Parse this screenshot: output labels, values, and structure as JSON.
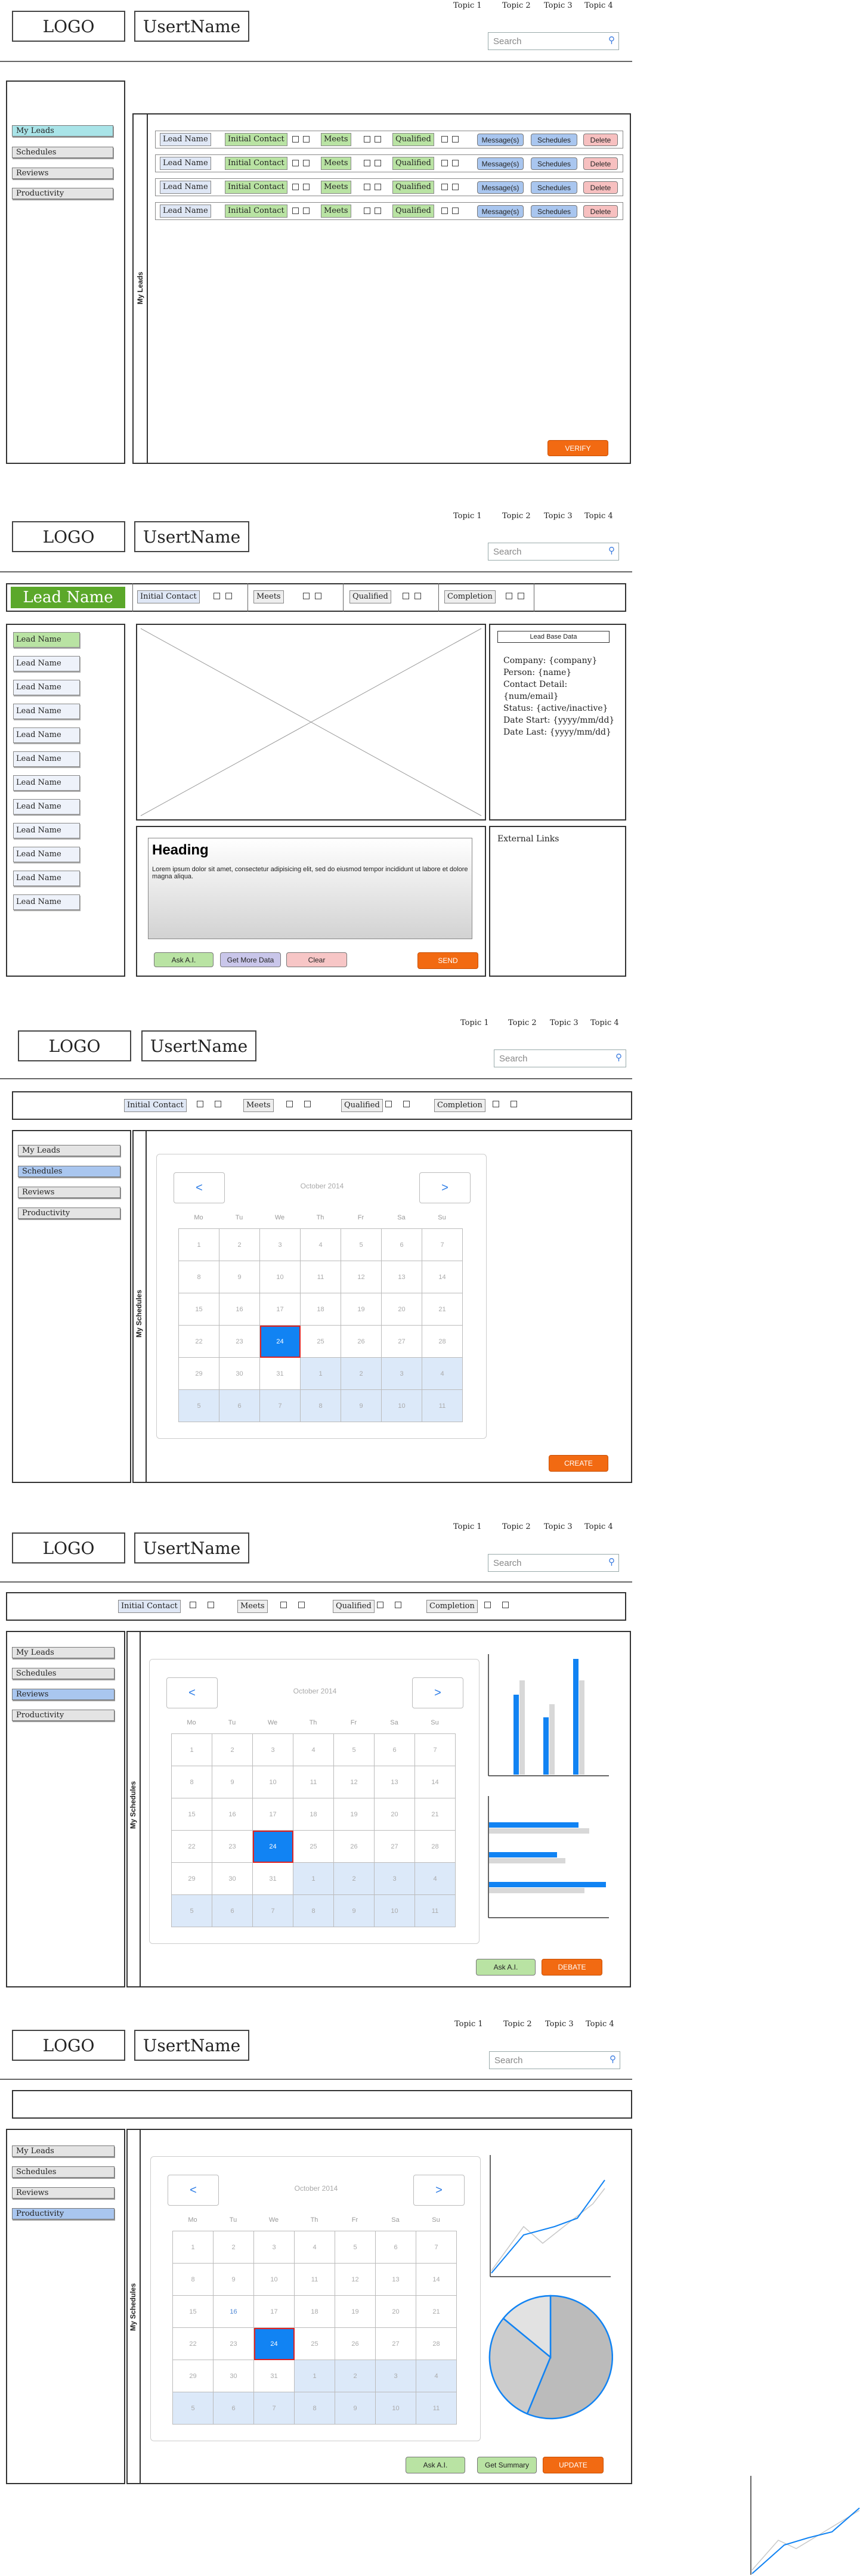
{
  "header": {
    "logo": "LOGO",
    "username": "UsertName",
    "topics": [
      "Topic 1",
      "Topic 2",
      "Topic 3",
      "Topic 4"
    ],
    "search_placeholder": "Search"
  },
  "sidebar_items": [
    "My Leads",
    "Schedules",
    "Reviews",
    "Productivity"
  ],
  "status_chips": {
    "initial": "Initial Contact",
    "meets": "Meets",
    "qualified": "Qualified",
    "completion": "Completion"
  },
  "screen1": {
    "vertical_label": "My Leads",
    "rows": [
      {
        "lead": "Lead Name",
        "initial": "Initial Contact",
        "meets": "Meets",
        "qualified": "Qualified",
        "messages": "Message(s)",
        "schedules": "Schedules",
        "delete": "Delete"
      },
      {
        "lead": "Lead Name",
        "initial": "Initial Contact",
        "meets": "Meets",
        "qualified": "Qualified",
        "messages": "Message(s)",
        "schedules": "Schedules",
        "delete": "Delete"
      },
      {
        "lead": "Lead Name",
        "initial": "Initial Contact",
        "meets": "Meets",
        "qualified": "Qualified",
        "messages": "Message(s)",
        "schedules": "Schedules",
        "delete": "Delete"
      },
      {
        "lead": "Lead Name",
        "initial": "Initial Contact",
        "meets": "Meets",
        "qualified": "Qualified",
        "messages": "Message(s)",
        "schedules": "Schedules",
        "delete": "Delete"
      }
    ],
    "verify_label": "VERIFY"
  },
  "screen2": {
    "lead_banner": "Lead Name",
    "lead_list": [
      "Lead Name",
      "Lead Name",
      "Lead Name",
      "Lead Name",
      "Lead Name",
      "Lead Name",
      "Lead Name",
      "Lead Name",
      "Lead Name",
      "Lead Name",
      "Lead Name",
      "Lead Name"
    ],
    "heading": "Heading",
    "paragraph": "Lorem ipsum dolor sit amet, consectetur adipisicing elit, sed do eiusmod tempor incididunt ut labore et dolore magna aliqua.",
    "buttons": {
      "ask": "Ask A.I.",
      "more": "Get More Data",
      "clear": "Clear",
      "send": "SEND"
    },
    "lead_base_title": "Lead Base Data",
    "details": [
      "Company: {company}",
      "Person: {name}",
      "Contact Detail: {num/email}",
      "Status: {active/inactive}",
      "Date Start: {yyyy/mm/dd}",
      "Date Last: {yyyy/mm/dd}"
    ],
    "external_links": "External Links"
  },
  "calendar": {
    "month": "October 2014",
    "prev": "<",
    "next": ">",
    "dow": [
      "Mo",
      "Tu",
      "We",
      "Th",
      "Fr",
      "Sa",
      "Su"
    ],
    "days": [
      "1",
      "2",
      "3",
      "4",
      "5",
      "6",
      "7",
      "8",
      "9",
      "10",
      "11",
      "12",
      "13",
      "14",
      "15",
      "16",
      "17",
      "18",
      "19",
      "20",
      "21",
      "22",
      "23",
      "24",
      "25",
      "26",
      "27",
      "28",
      "29",
      "30",
      "31",
      "1",
      "2",
      "3",
      "4",
      "5",
      "6",
      "7",
      "8",
      "9",
      "10",
      "11"
    ],
    "today": "24"
  },
  "screen3": {
    "vertical_label": "My Schedules",
    "create": "CREATE"
  },
  "screen4": {
    "vertical_label": "My Schedules",
    "ask": "Ask A.I.",
    "debate": "DEBATE"
  },
  "screen5": {
    "vertical_label": "My Schedules",
    "ask": "Ask A.I.",
    "summary": "Get Summary",
    "update": "UPDATE"
  },
  "colors": {
    "accent_orange": "#f26a12",
    "blue": "#1183f3",
    "light_blue": "#dce9f9",
    "green": "#b9e3a3"
  }
}
